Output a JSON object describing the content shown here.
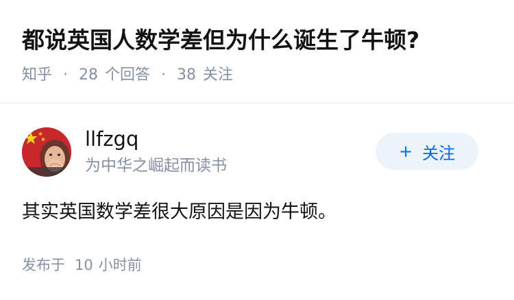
{
  "question": {
    "title": "都说英国人数学差但为什么诞生了牛顿?",
    "meta": {
      "site": "知乎",
      "separator": "·",
      "answer_count": "28",
      "answer_label": "个回答",
      "follower_count": "38",
      "follower_label": "关注"
    }
  },
  "author": {
    "avatar_icon": "avatar-flag-photo",
    "name": "llfzgq",
    "bio": "为中华之崛起而读书",
    "follow_plus": "+",
    "follow_label": "关注"
  },
  "answer": {
    "content": "其实英国数学差很大原因是因为牛顿。",
    "time_prefix": "发布于",
    "time_value": "10",
    "time_suffix": "小时前"
  },
  "colors": {
    "title": "#121212",
    "meta": "#8590a6",
    "follow_bg": "#ebf3fb",
    "follow_text": "#0066ff",
    "divider": "#ececec"
  }
}
